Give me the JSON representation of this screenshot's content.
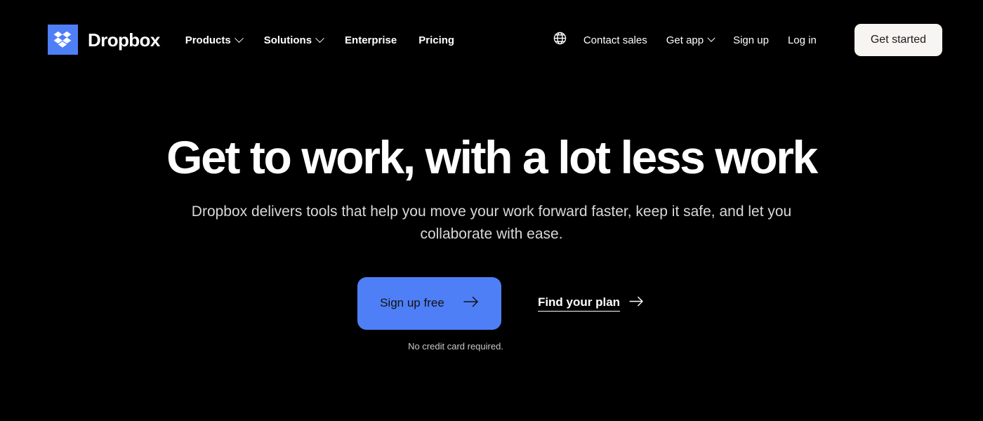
{
  "brand": {
    "name": "Dropbox",
    "logo_icon": "dropbox-logo-icon",
    "logo_color": "#4F7FF7"
  },
  "header": {
    "nav_primary": [
      {
        "label": "Products",
        "has_dropdown": true
      },
      {
        "label": "Solutions",
        "has_dropdown": true
      },
      {
        "label": "Enterprise",
        "has_dropdown": false
      },
      {
        "label": "Pricing",
        "has_dropdown": false
      }
    ],
    "language_icon": "globe-icon",
    "nav_secondary": [
      {
        "label": "Contact sales",
        "has_dropdown": false
      },
      {
        "label": "Get app",
        "has_dropdown": true
      },
      {
        "label": "Sign up",
        "has_dropdown": false
      },
      {
        "label": "Log in",
        "has_dropdown": false
      }
    ],
    "get_started_label": "Get started",
    "get_started_bg": "#F7F5F2",
    "get_started_text_color": "#1E1919"
  },
  "hero": {
    "title": "Get to work, with a lot less work",
    "subtitle": "Dropbox delivers tools that help you move your work forward faster, keep it safe, and let you collaborate with ease.",
    "primary_cta": {
      "label": "Sign up free",
      "icon": "arrow-right-icon",
      "bg": "#4F7FF7",
      "text_color": "#14120F"
    },
    "secondary_cta": {
      "label": "Find your plan",
      "icon": "arrow-right-icon"
    },
    "fineprint": "No credit card required."
  },
  "theme": {
    "background": "#000000",
    "text_primary": "#FFFFFF",
    "text_muted": "#D9D9D9",
    "accent_blue": "#4F7FF7"
  }
}
